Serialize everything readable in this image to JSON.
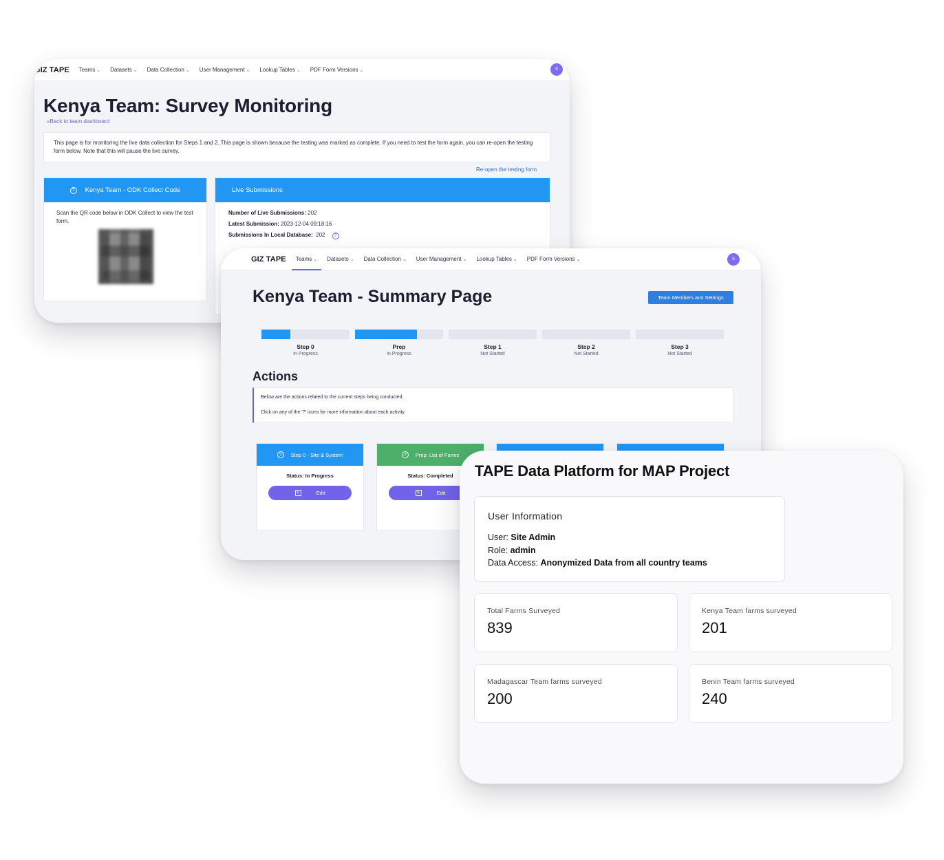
{
  "nav": {
    "brand": "GIZ TAPE",
    "items": [
      "Teams",
      "Datasets",
      "Data Collection",
      "User Management",
      "Lookup Tables",
      "PDF Form Versions"
    ],
    "avatar_initial": "S"
  },
  "monitoring": {
    "title": "Kenya Team: Survey Monitoring",
    "back_link": "Back to team dashboard",
    "info_text": "This page is for monitoring the live data collection for Steps 1 and 2. This page is shown because the testing was marked as complete. If you need to test the form again, you can re-open the testing form below. Note that this will pause the live survey.",
    "reopen_link": "Re-open the testing form",
    "odk_panel": {
      "title": "Kenya Team - ODK Collect Code",
      "text": "Scan the QR code below in ODK Collect to view the test form."
    },
    "live_panel": {
      "title": "Live Submissions",
      "rows": [
        {
          "label": "Number of Live Submissions:",
          "value": "202"
        },
        {
          "label": "Latest Submission:",
          "value": "2023-12-04 09:18:16"
        },
        {
          "label": "Submissions In Local Database:",
          "value": "202"
        }
      ]
    }
  },
  "summary": {
    "title": "Kenya Team - Summary Page",
    "team_button": "Team Members and Settings",
    "steps": [
      {
        "name": "Step 0",
        "state": "In Progress",
        "progress": 0.33
      },
      {
        "name": "Prep",
        "state": "In Progress",
        "progress": 0.7
      },
      {
        "name": "Step 1",
        "state": "Not Started",
        "progress": 0
      },
      {
        "name": "Step 2",
        "state": "Not Started",
        "progress": 0
      },
      {
        "name": "Step 3",
        "state": "Not Started",
        "progress": 0
      }
    ],
    "actions_title": "Actions",
    "actions_text_1": "Below are the actions related to the current steps being conducted.",
    "actions_text_2": "Click on any of the '?' icons for more information about each activity.",
    "action_cards": [
      {
        "title": "Step 0 - Site & System",
        "status": "Status: In Progress",
        "edit": "Edit",
        "color": "#2196f3"
      },
      {
        "title": "Prep: List of Farms",
        "status": "Status: Completed",
        "edit": "Edit",
        "color": "#4caf6a"
      },
      {
        "title": "",
        "status": "",
        "edit": "",
        "color": "#2196f3"
      },
      {
        "title": "",
        "status": "",
        "edit": "",
        "color": "#2196f3"
      }
    ]
  },
  "platform": {
    "title": "TAPE Data Platform for MAP Project",
    "user_info": {
      "heading": "User Information",
      "user_label": "User:",
      "user_value": "Site Admin",
      "role_label": "Role:",
      "role_value": "admin",
      "access_label": "Data Access:",
      "access_value": "Anonymized Data from all country teams"
    },
    "stats": [
      {
        "label": "Total Farms Surveyed",
        "value": "839"
      },
      {
        "label": "Kenya Team farms surveyed",
        "value": "201"
      },
      {
        "label": "Madagascar Team farms surveyed",
        "value": "200"
      },
      {
        "label": "Benin Team farms surveyed",
        "value": "240"
      }
    ]
  }
}
